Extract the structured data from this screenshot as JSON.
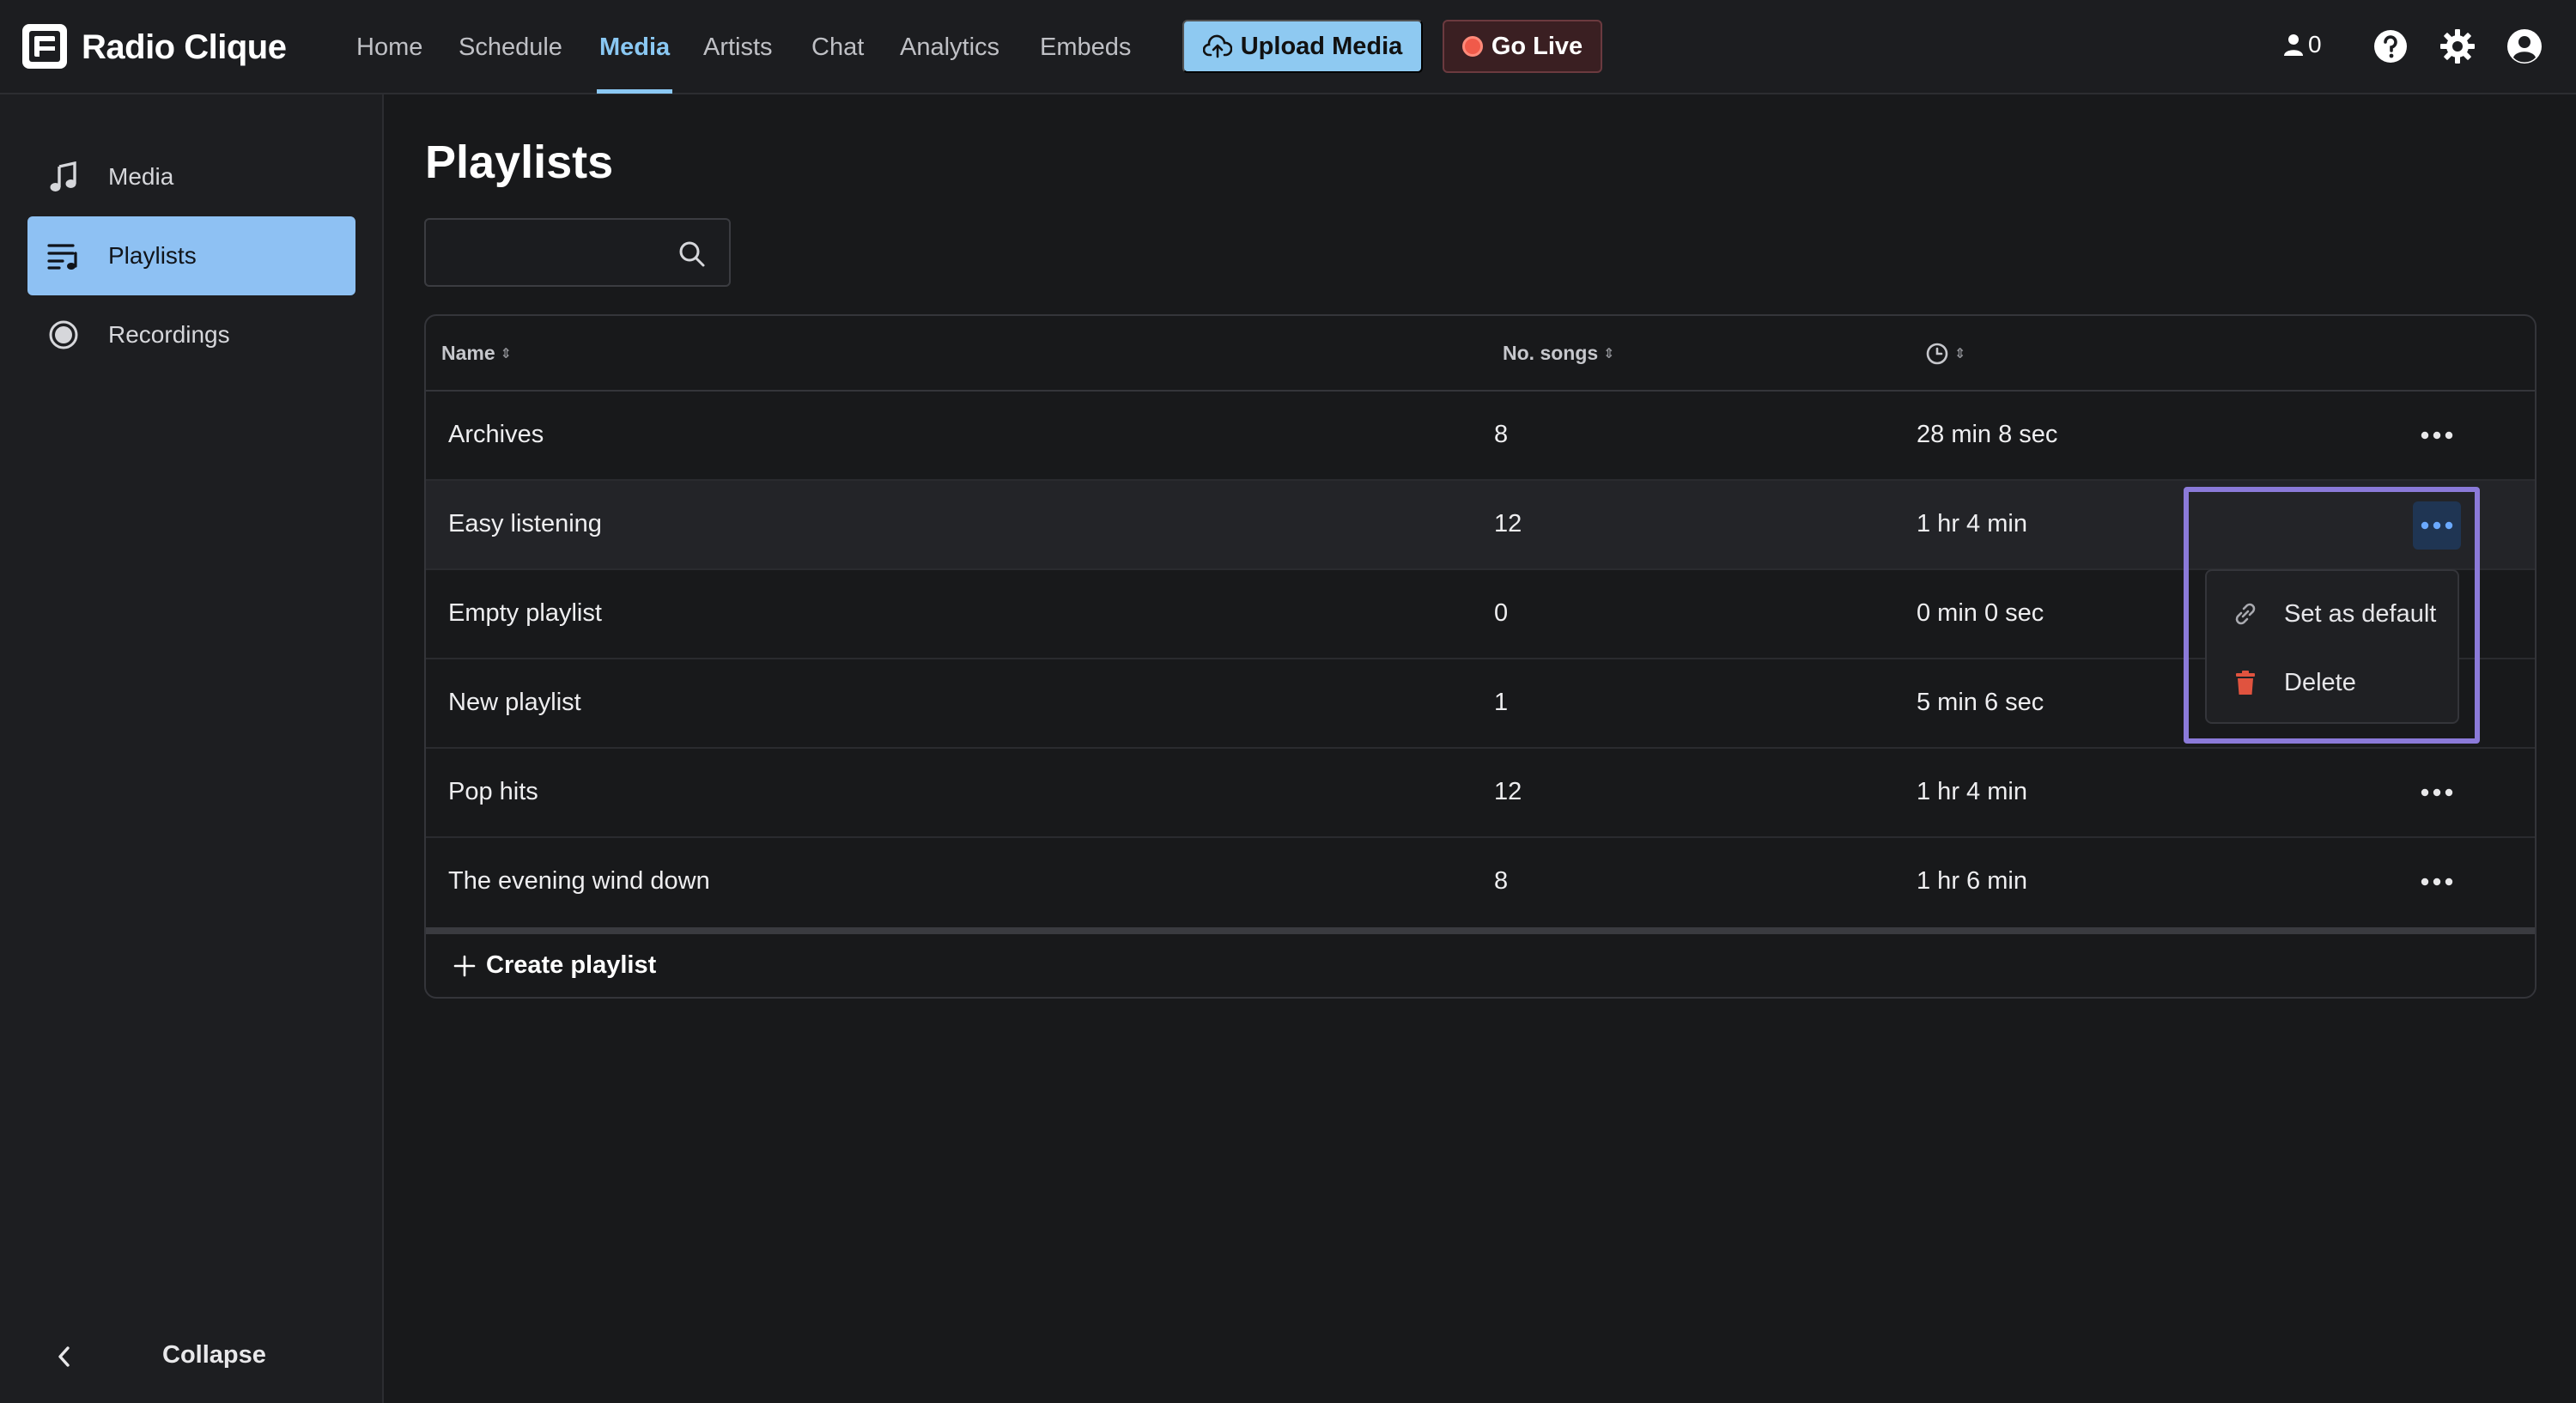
{
  "app": {
    "title": "Radio Clique"
  },
  "nav": [
    {
      "label": "Home",
      "active": false
    },
    {
      "label": "Schedule",
      "active": false
    },
    {
      "label": "Media",
      "active": true
    },
    {
      "label": "Artists",
      "active": false
    },
    {
      "label": "Chat",
      "active": false
    },
    {
      "label": "Analytics",
      "active": false
    },
    {
      "label": "Embeds",
      "active": false
    }
  ],
  "actions": {
    "upload_label": "Upload Media",
    "live_label": "Go Live",
    "listener_count": "0"
  },
  "sidebar": {
    "items": [
      {
        "label": "Media",
        "icon": "music-note-icon",
        "active": false
      },
      {
        "label": "Playlists",
        "icon": "playlist-icon",
        "active": true
      },
      {
        "label": "Recordings",
        "icon": "record-icon",
        "active": false
      }
    ],
    "collapse_label": "Collapse"
  },
  "main": {
    "title": "Playlists",
    "search": {
      "value": "",
      "placeholder": ""
    },
    "table": {
      "columns": {
        "name": "Name",
        "songs": "No. songs",
        "duration_icon": "clock-icon"
      },
      "rows": [
        {
          "name": "Archives",
          "songs": "8",
          "duration": "28 min 8 sec"
        },
        {
          "name": "Easy listening",
          "songs": "12",
          "duration": "1 hr 4 min"
        },
        {
          "name": "Empty playlist",
          "songs": "0",
          "duration": "0 min 0 sec"
        },
        {
          "name": "New playlist",
          "songs": "1",
          "duration": "5 min 6 sec"
        },
        {
          "name": "Pop hits",
          "songs": "12",
          "duration": "1 hr 4 min"
        },
        {
          "name": "The evening wind down",
          "songs": "8",
          "duration": "1 hr 6 min"
        }
      ],
      "create_label": "Create playlist"
    },
    "menu": {
      "items": [
        {
          "label": "Set as default",
          "icon": "link-icon"
        },
        {
          "label": "Delete",
          "icon": "trash-icon"
        }
      ]
    }
  },
  "colors": {
    "accent": "#8ac8f3",
    "upload_bg": "#8ec9f1",
    "live_dot": "#f05a4a",
    "highlight": "#8b7ad9",
    "delete_icon": "#e0533f"
  }
}
